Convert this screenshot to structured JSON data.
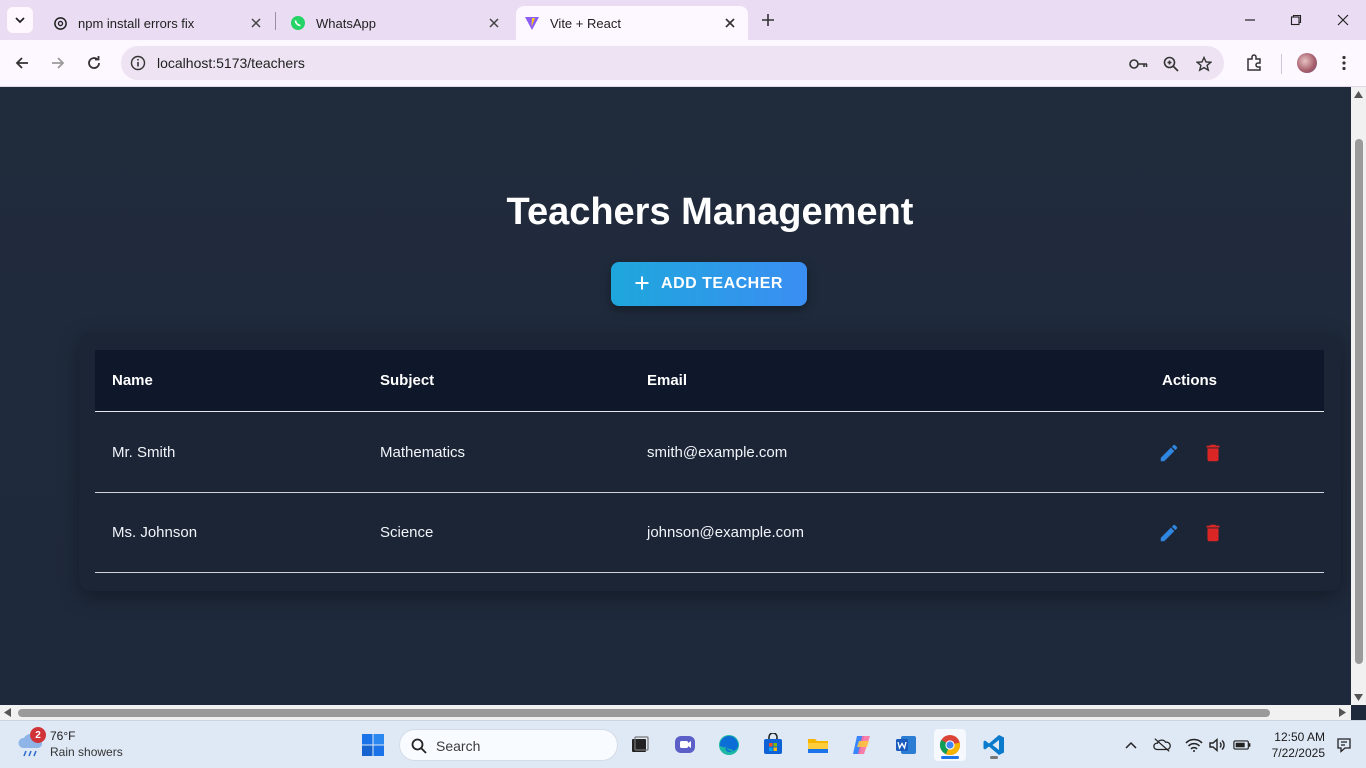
{
  "browser": {
    "tabs": [
      {
        "title": "npm install errors fix",
        "icon": "openai-icon"
      },
      {
        "title": "WhatsApp",
        "icon": "whatsapp-icon"
      },
      {
        "title": "Vite + React",
        "icon": "vite-icon",
        "active": true
      }
    ],
    "url": "localhost:5173/teachers"
  },
  "page": {
    "title": "Teachers Management",
    "add_button_label": "ADD TEACHER",
    "add_button_icon": "plus-icon",
    "table": {
      "headers": {
        "name": "Name",
        "subject": "Subject",
        "email": "Email",
        "actions": "Actions"
      },
      "rows": [
        {
          "name": "Mr. Smith",
          "subject": "Mathematics",
          "email": "smith@example.com"
        },
        {
          "name": "Ms. Johnson",
          "subject": "Science",
          "email": "johnson@example.com"
        }
      ],
      "row_actions": [
        "edit-icon",
        "delete-icon"
      ]
    }
  },
  "colors": {
    "background": "#1e293b",
    "card": "#1b2536",
    "table_header": "#0f172a",
    "accent_start": "#1ea7dc",
    "accent_end": "#3b8ef3",
    "edit": "#3b82f6",
    "delete": "#dc2626"
  },
  "taskbar": {
    "weather": {
      "badge": "2",
      "temp": "76°F",
      "desc": "Rain showers"
    },
    "search_label": "Search",
    "clock": {
      "time": "12:50 AM",
      "date": "7/22/2025"
    }
  }
}
